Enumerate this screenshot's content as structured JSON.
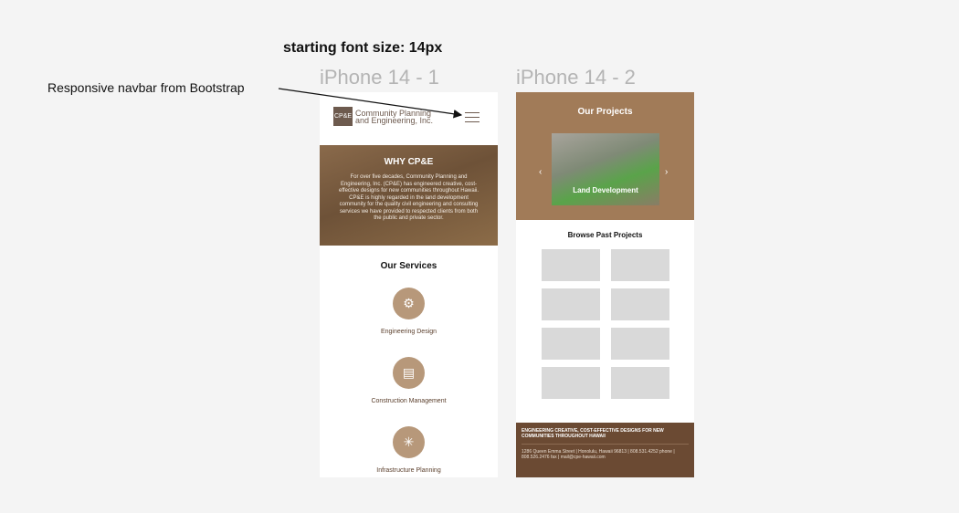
{
  "canvas": {
    "note_title": "starting font size: 14px",
    "frame1_label": "iPhone 14 - 1",
    "frame2_label": "iPhone 14 - 2",
    "annotation": "Responsive navbar from Bootstrap"
  },
  "phone1": {
    "logo_mark": "CP&E",
    "logo_line1": "Community Planning",
    "logo_line2": "and Engineering, Inc.",
    "why_title": "WHY CP&E",
    "why_text": "For over five decades, Community Planning and Engineering, Inc. (CP&E) has engineered creative, cost-effective designs for new communities throughout Hawaii. CP&E is highly regarded in the land development community for the quality civil engineering and consulting services we have provided to respected clients from both the public and private sector.",
    "services_title": "Our Services",
    "services": [
      {
        "label": "Engineering Design",
        "icon": "gears-icon"
      },
      {
        "label": "Construction Management",
        "icon": "document-icon"
      },
      {
        "label": "Infrastructure Planning",
        "icon": "network-icon"
      }
    ]
  },
  "phone2": {
    "projects_title": "Our Projects",
    "slide_caption": "Land Development",
    "prev_glyph": "‹",
    "next_glyph": "›",
    "browse_title": "Browse Past Projects",
    "thumb_count": 8,
    "footer_tagline": "ENGINEERING CREATIVE, COST-EFFECTIVE DESIGNS FOR NEW COMMUNITIES THROUGHOUT HAWAII",
    "footer_address": "1286 Queen Emma Street   |   Honolulu, Hawaii 96813   |   808.531.4252 phone   |   808.526.2476 fax   |   mail@cpe-hawaii.com"
  },
  "colors": {
    "brand_brown": "#6d5a4e",
    "accent_tan": "#b7987a",
    "projects_bg": "#a17b58",
    "footer_bg": "#6b4a33"
  }
}
